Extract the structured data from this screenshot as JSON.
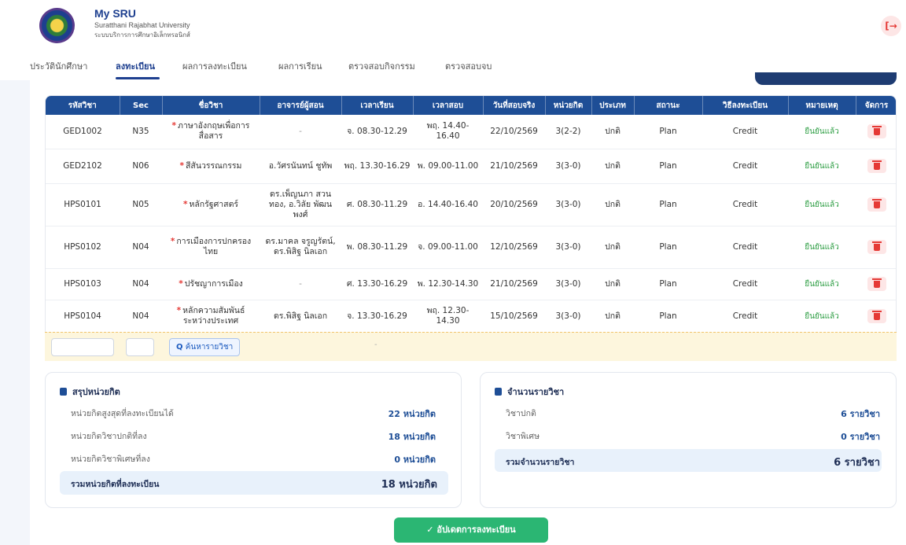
{
  "header": {
    "title": "My SRU",
    "subtitle_en": "Suratthani Rajabhat University",
    "subtitle_th": "ระบบบริการการศึกษาอิเล็กทรอนิกส์",
    "logout_icon": "logout-icon",
    "logout_glyph": "[→"
  },
  "tabs": [
    {
      "label": "ประวัตินักศึกษา"
    },
    {
      "label": "ลงทะเบียน"
    },
    {
      "label": "ผลการลงทะเบียน"
    },
    {
      "label": "ผลการเรียน"
    },
    {
      "label": "ตรวจสอบกิจกรรม"
    },
    {
      "label": "ตรวจสอบจบ"
    }
  ],
  "table": {
    "columns": [
      "รหัสวิชา",
      "Sec",
      "ชื่อวิชา",
      "อาจารย์ผู้สอน",
      "เวลาเรียน",
      "เวลาสอบ",
      "วันที่สอบจริง",
      "หน่วยกิต",
      "ประเภท",
      "สถานะ",
      "วิธีลงทะเบียน",
      "หมายเหตุ",
      "จัดการ"
    ],
    "rows": [
      {
        "code": "GED1002",
        "sec": "N35",
        "name": "ภาษาอังกฤษเพื่อการสื่อสาร",
        "teacher": "-",
        "class_time": "จ. 08.30-12.29",
        "exam_time": "พฤ. 14.40-16.40",
        "exam_date": "22/10/2569",
        "credit": "3(2-2)",
        "type": "ปกติ",
        "status": "Plan",
        "method": "Credit",
        "note": "ยืนยันแล้ว"
      },
      {
        "code": "GED2102",
        "sec": "N06",
        "name": "สีสันวรรณกรรม",
        "teacher": "อ.วัศรนันทน์ ชูทัพ",
        "class_time": "พฤ. 13.30-16.29",
        "exam_time": "พ. 09.00-11.00",
        "exam_date": "21/10/2569",
        "credit": "3(3-0)",
        "type": "ปกติ",
        "status": "Plan",
        "method": "Credit",
        "note": "ยืนยันแล้ว"
      },
      {
        "code": "HPS0101",
        "sec": "N05",
        "name": "หลักรัฐศาสตร์",
        "teacher": "ดร.เพ็ญนภา สวนทอง, อ.วิลัย พัฒนพงศ์",
        "class_time": "ศ. 08.30-11.29",
        "exam_time": "อ. 14.40-16.40",
        "exam_date": "20/10/2569",
        "credit": "3(3-0)",
        "type": "ปกติ",
        "status": "Plan",
        "method": "Credit",
        "note": "ยืนยันแล้ว"
      },
      {
        "code": "HPS0102",
        "sec": "N04",
        "name": "การเมืองการปกครองไทย",
        "teacher": "ดร.มาคล จรูญรัตน์, ดร.พิสิฐ นิลเอก",
        "class_time": "พ. 08.30-11.29",
        "exam_time": "จ. 09.00-11.00",
        "exam_date": "12/10/2569",
        "credit": "3(3-0)",
        "type": "ปกติ",
        "status": "Plan",
        "method": "Credit",
        "note": "ยืนยันแล้ว"
      },
      {
        "code": "HPS0103",
        "sec": "N04",
        "name": "ปรัชญาการเมือง",
        "teacher": "-",
        "class_time": "ศ. 13.30-16.29",
        "exam_time": "พ. 12.30-14.30",
        "exam_date": "21/10/2569",
        "credit": "3(3-0)",
        "type": "ปกติ",
        "status": "Plan",
        "method": "Credit",
        "note": "ยืนยันแล้ว"
      },
      {
        "code": "HPS0104",
        "sec": "N04",
        "name": "หลักความสัมพันธ์ระหว่างประเทศ",
        "teacher": "ดร.พิสิฐ นิลเอก",
        "class_time": "จ. 13.30-16.29",
        "exam_time": "พฤ. 12.30-14.30",
        "exam_date": "15/10/2569",
        "credit": "3(3-0)",
        "type": "ปกติ",
        "status": "Plan",
        "method": "Credit",
        "note": "ยืนยันแล้ว"
      }
    ],
    "required_marker": "*",
    "delete_icon": "trash-icon"
  },
  "search": {
    "button_label": "ค้นหารายวิชา",
    "search_icon": "search-icon",
    "search_glyph": "Q",
    "placeholder_dash": "-"
  },
  "credit_summary": {
    "title": "สรุปหน่วยกิต",
    "icon": "table-icon",
    "rows": [
      {
        "label": "หน่วยกิตสูงสุดที่ลงทะเบียนได้",
        "value": "22 หน่วยกิต"
      },
      {
        "label": "หน่วยกิตวิชาปกติที่ลง",
        "value": "18 หน่วยกิต"
      },
      {
        "label": "หน่วยกิตวิชาพิเศษที่ลง",
        "value": "0 หน่วยกิต"
      }
    ],
    "total_label": "รวมหน่วยกิตที่ลงทะเบียน",
    "total_value": "18 หน่วยกิต"
  },
  "course_count": {
    "title": "จำนวนรายวิชา",
    "icon": "table-icon",
    "rows": [
      {
        "label": "วิชาปกติ",
        "value": "6 รายวิชา"
      },
      {
        "label": "วิชาพิเศษ",
        "value": "0 รายวิชา"
      }
    ],
    "total_label": "รวมจำนวนรายวิชา",
    "total_value": "6 รายวิชา"
  },
  "update_button": {
    "label": "อัปเดตการลงทะเบียน",
    "icon": "check-icon",
    "glyph": "✓"
  },
  "colors": {
    "primary": "#1e4e96",
    "accent_green": "#2bb673",
    "danger": "#e53935",
    "search_row_bg": "#fdf6dd"
  }
}
